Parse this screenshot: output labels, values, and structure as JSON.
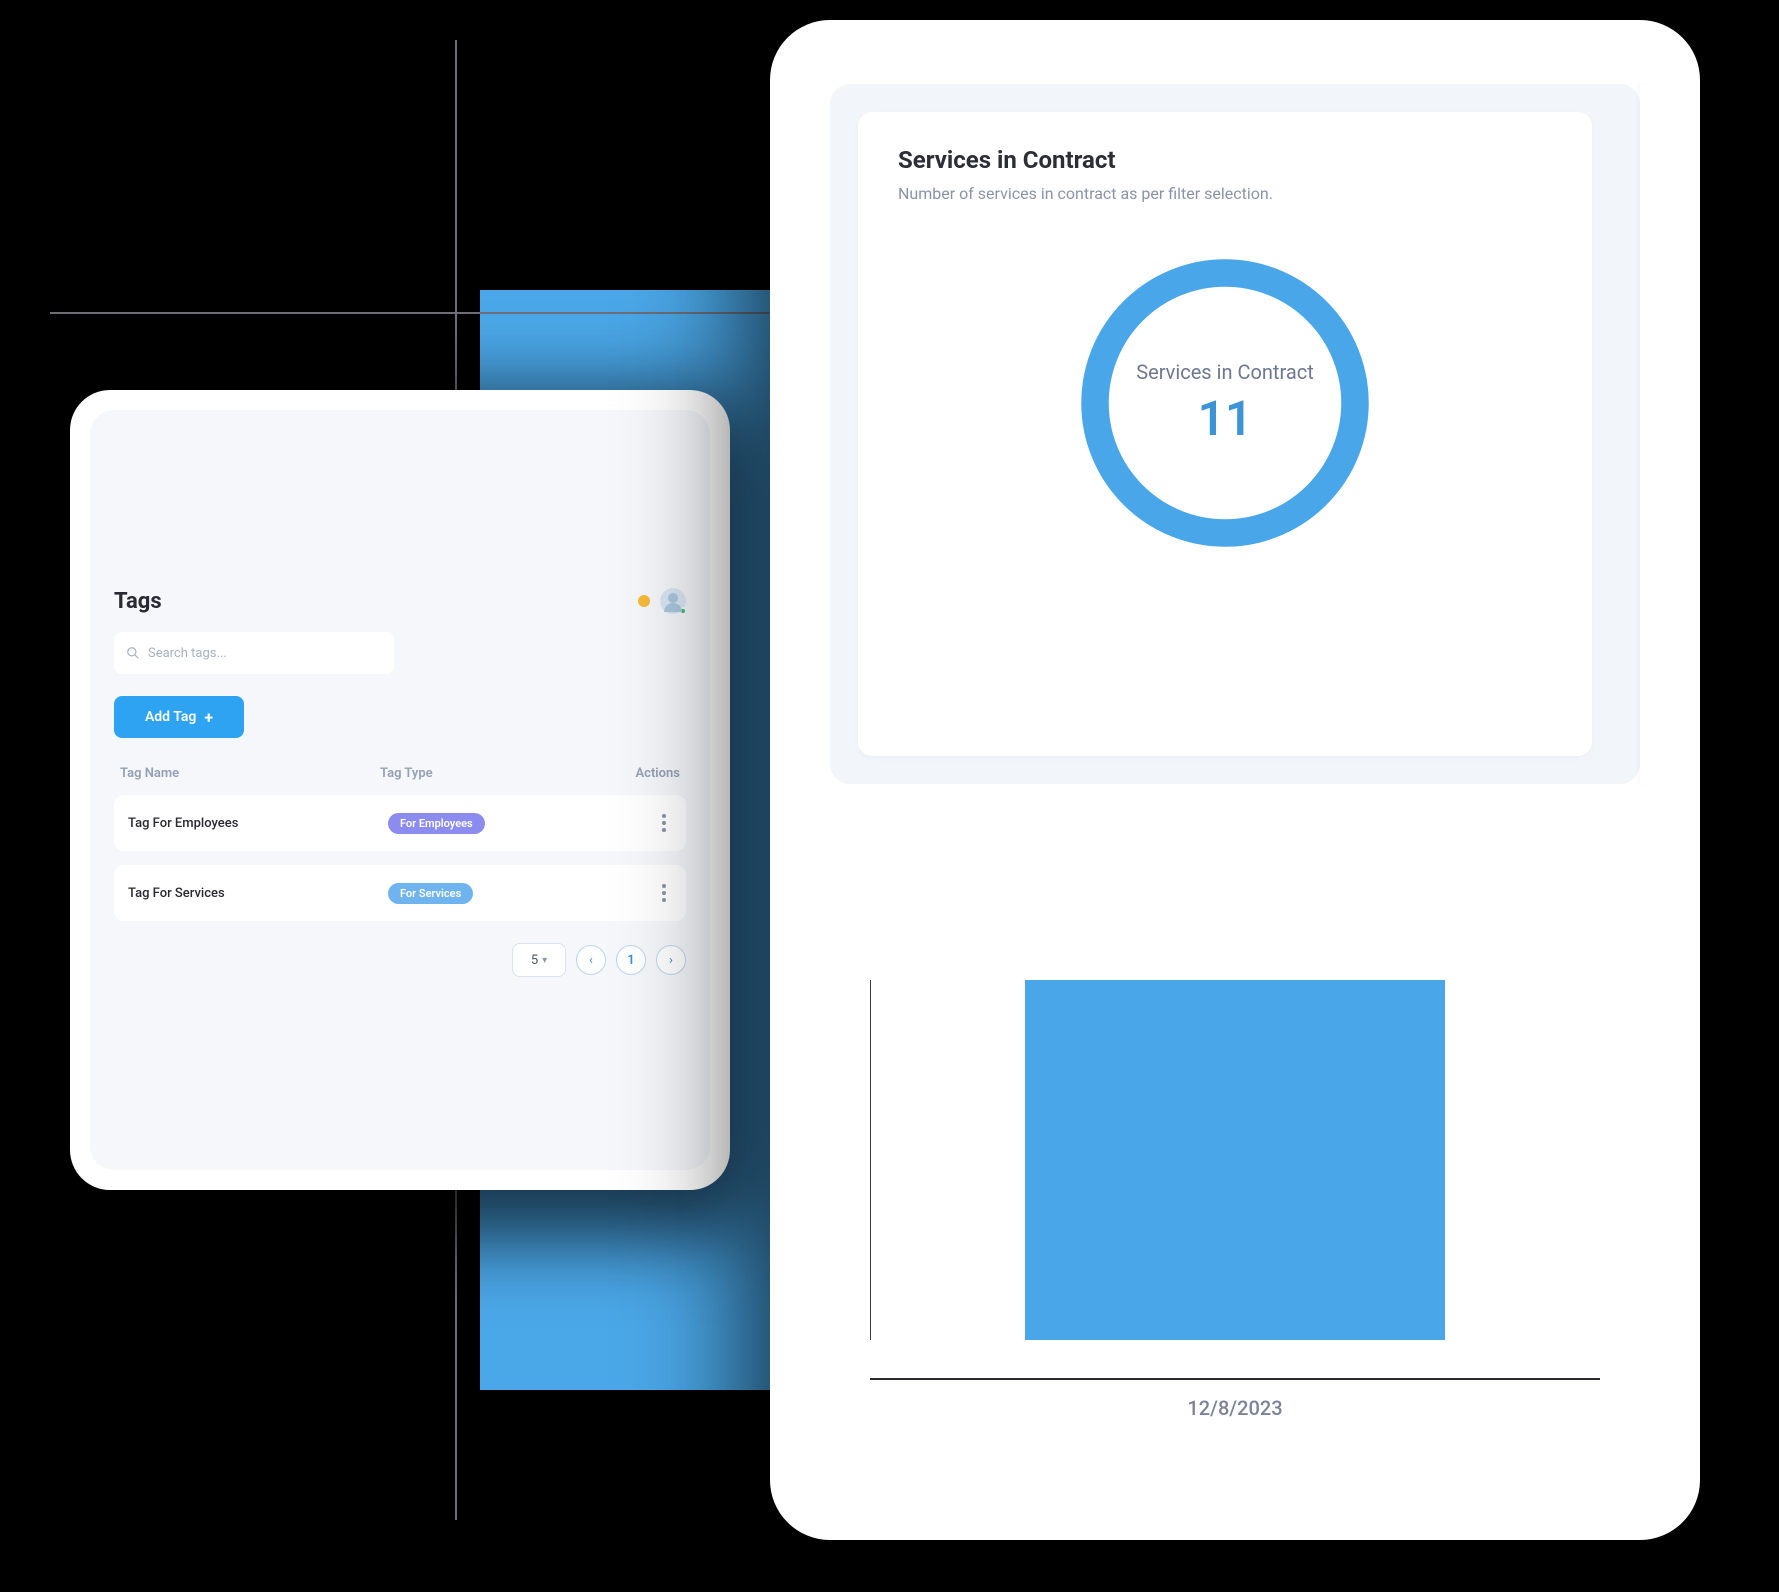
{
  "left": {
    "title": "Tags",
    "search_placeholder": "Search tags...",
    "add_button": "Add Tag",
    "columns": {
      "name": "Tag Name",
      "type": "Tag Type",
      "actions": "Actions"
    },
    "rows": [
      {
        "name": "Tag For Employees",
        "type_label": "For Employees",
        "type_color": "purple"
      },
      {
        "name": "Tag For Services",
        "type_label": "For Services",
        "type_color": "blue"
      }
    ],
    "page_size": "5",
    "current_page": "1"
  },
  "right": {
    "card_title": "Services in Contract",
    "card_subtitle": "Number of services in contract as per filter selection.",
    "ring_label": "Services in Contract",
    "ring_value": "11",
    "bar_date": "12/8/2023"
  },
  "chart_data": [
    {
      "type": "pie",
      "title": "Services in Contract",
      "series": [
        {
          "name": "Services in Contract",
          "values": [
            11
          ]
        }
      ]
    },
    {
      "type": "bar",
      "categories": [
        "12/8/2023"
      ],
      "values": [
        1
      ],
      "xlabel": "",
      "ylabel": "",
      "ylim": [
        0,
        1
      ]
    }
  ]
}
